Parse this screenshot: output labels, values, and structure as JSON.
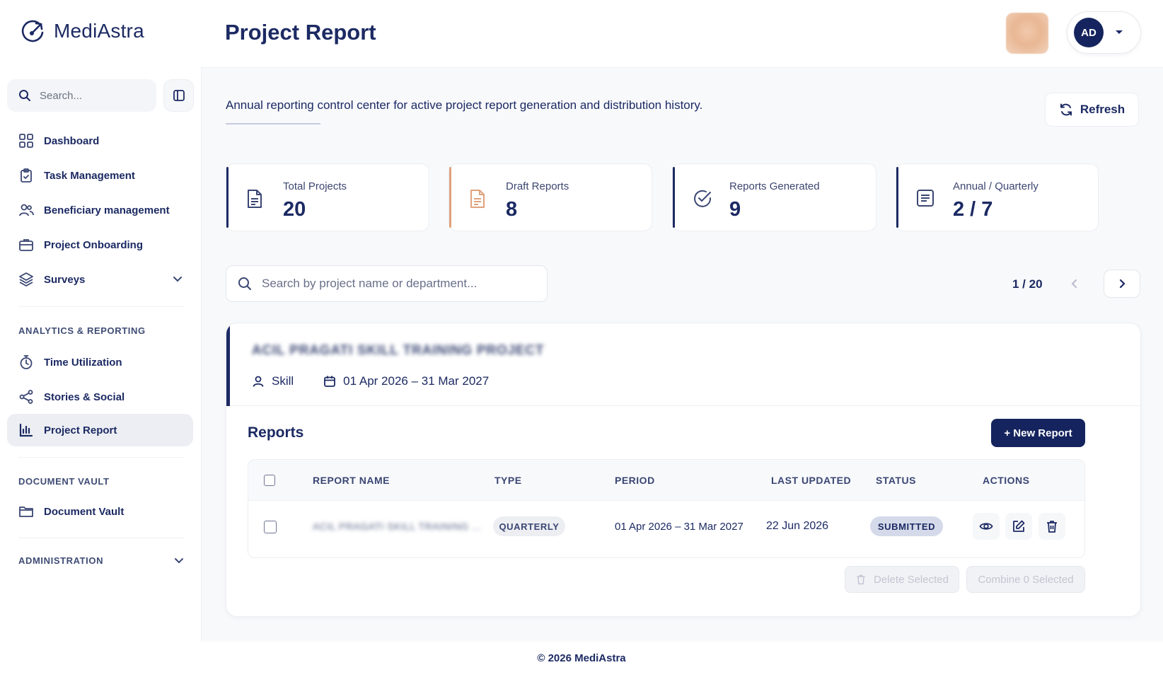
{
  "brand": {
    "name": "MediAstra"
  },
  "sidebar": {
    "search_placeholder": "Search...",
    "items": [
      {
        "label": "Dashboard",
        "icon": "grid-icon"
      },
      {
        "label": "Task Management",
        "icon": "clipboard-icon"
      },
      {
        "label": "Beneficiary management",
        "icon": "users-icon"
      },
      {
        "label": "Project Onboarding",
        "icon": "briefcase-icon"
      },
      {
        "label": "Surveys",
        "icon": "layers-icon"
      }
    ],
    "section_analytics": "ANALYTICS & REPORTING",
    "analytics_items": [
      {
        "label": "Time Utilization",
        "icon": "stopwatch-icon"
      },
      {
        "label": "Stories & Social",
        "icon": "share-icon"
      },
      {
        "label": "Project Report",
        "icon": "bar-chart-icon"
      }
    ],
    "section_vault": "DOCUMENT VAULT",
    "vault_items": [
      {
        "label": "Document Vault",
        "icon": "folder-icon"
      }
    ],
    "section_admin": "ADMINISTRATION"
  },
  "header": {
    "title": "Project Report",
    "user_initials": "AD"
  },
  "main": {
    "subtitle": "Annual reporting control center for active project report generation and distribution history.",
    "refresh_label": "Refresh",
    "stats": [
      {
        "label": "Total Projects",
        "value": "20",
        "icon": "document-icon",
        "accent": "#1c2a63"
      },
      {
        "label": "Draft Reports",
        "value": "8",
        "icon": "draft-document-icon",
        "accent": "#e0a27c"
      },
      {
        "label": "Reports Generated",
        "value": "9",
        "icon": "check-circle-icon",
        "accent": "#1c2a63"
      },
      {
        "label": "Annual / Quarterly",
        "value": "2 / 7",
        "icon": "list-document-icon",
        "accent": "#1c2a63"
      }
    ],
    "project_search_placeholder": "Search by project name or department...",
    "pager": "1 / 20",
    "project": {
      "name": "ACIL PRAGATI SKILL TRAINING PROJECT",
      "department": "Skill",
      "period": "01 Apr 2026 – 31 Mar 2027"
    },
    "reports": {
      "title": "Reports",
      "new_report_label": "+ New Report",
      "columns": [
        "REPORT NAME",
        "TYPE",
        "PERIOD",
        "LAST UPDATED",
        "STATUS",
        "ACTIONS"
      ],
      "rows": [
        {
          "name": "ACIL PRAGATI SKILL TRAINING ...",
          "type": "QUARTERLY",
          "period": "01 Apr 2026 – 31 Mar 2027",
          "last_updated": "22 Jun 2026",
          "status": "SUBMITTED"
        }
      ],
      "delete_selected_label": "Delete Selected",
      "combine_selected_label": "Combine 0 Selected"
    }
  },
  "footer": {
    "text": "© 2026 MediAstra"
  }
}
